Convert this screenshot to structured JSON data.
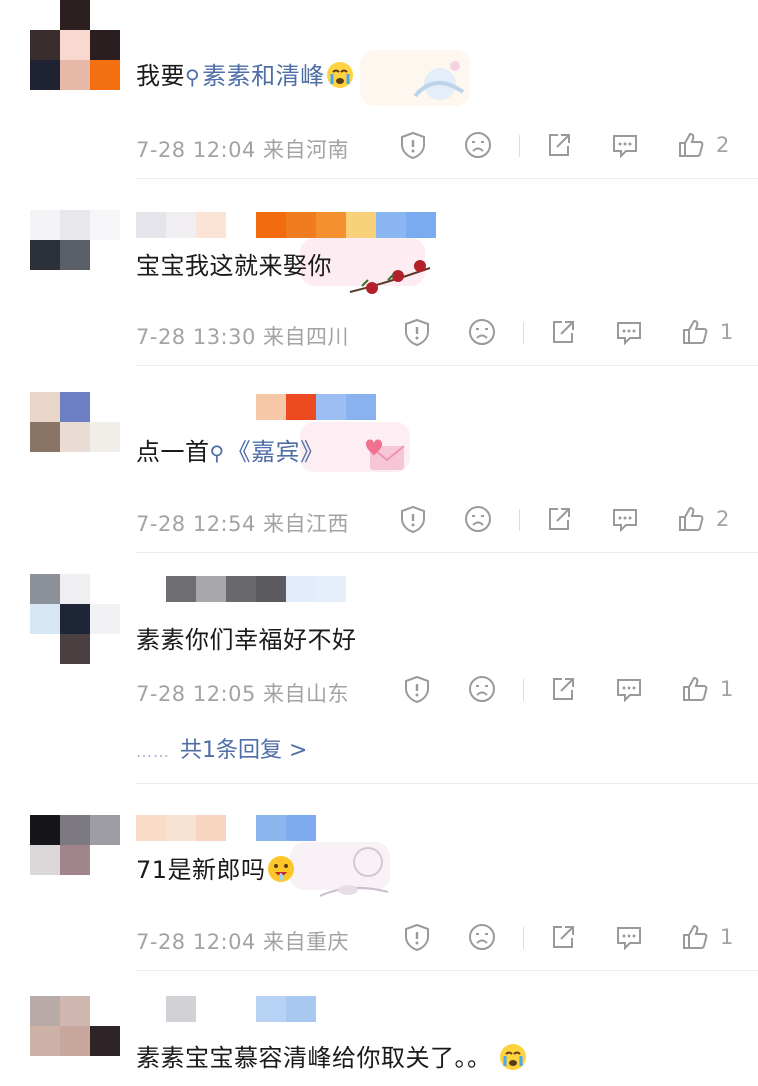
{
  "comments": [
    {
      "text_plain": "我要",
      "link_text": "素素和清峰",
      "time": "7-28 12:04",
      "location": "来自河南",
      "likes": "2",
      "emoji": "crying-emoji"
    },
    {
      "text_plain": "宝宝我这就来娶你",
      "time": "7-28 13:30",
      "location": "来自四川",
      "likes": "1"
    },
    {
      "text_plain": "点一首",
      "link_text": "《嘉宾》",
      "time": "7-28 12:54",
      "location": "来自江西",
      "likes": "2"
    },
    {
      "text_plain": "素素你们幸福好不好",
      "time": "7-28 12:05",
      "location": "来自山东",
      "likes": "1",
      "reply_dots": "……",
      "reply_link": "共1条回复 >"
    },
    {
      "text_plain": "71是新郎吗",
      "time": "7-28 12:04",
      "location": "来自重庆",
      "likes": "1",
      "emoji": "drooling-emoji"
    },
    {
      "text_plain": "素素宝宝慕容清峰给你取关了。。",
      "emoji": "crying-emoji"
    }
  ],
  "icons": {
    "report": "shield-exclamation-icon",
    "dislike": "frown-face-icon",
    "share": "share-icon",
    "comment": "comment-icon",
    "like": "thumbs-up-icon"
  },
  "colors": {
    "link": "#4f6ea6",
    "meta": "#a3a3a3",
    "text": "#1a1a1a"
  }
}
